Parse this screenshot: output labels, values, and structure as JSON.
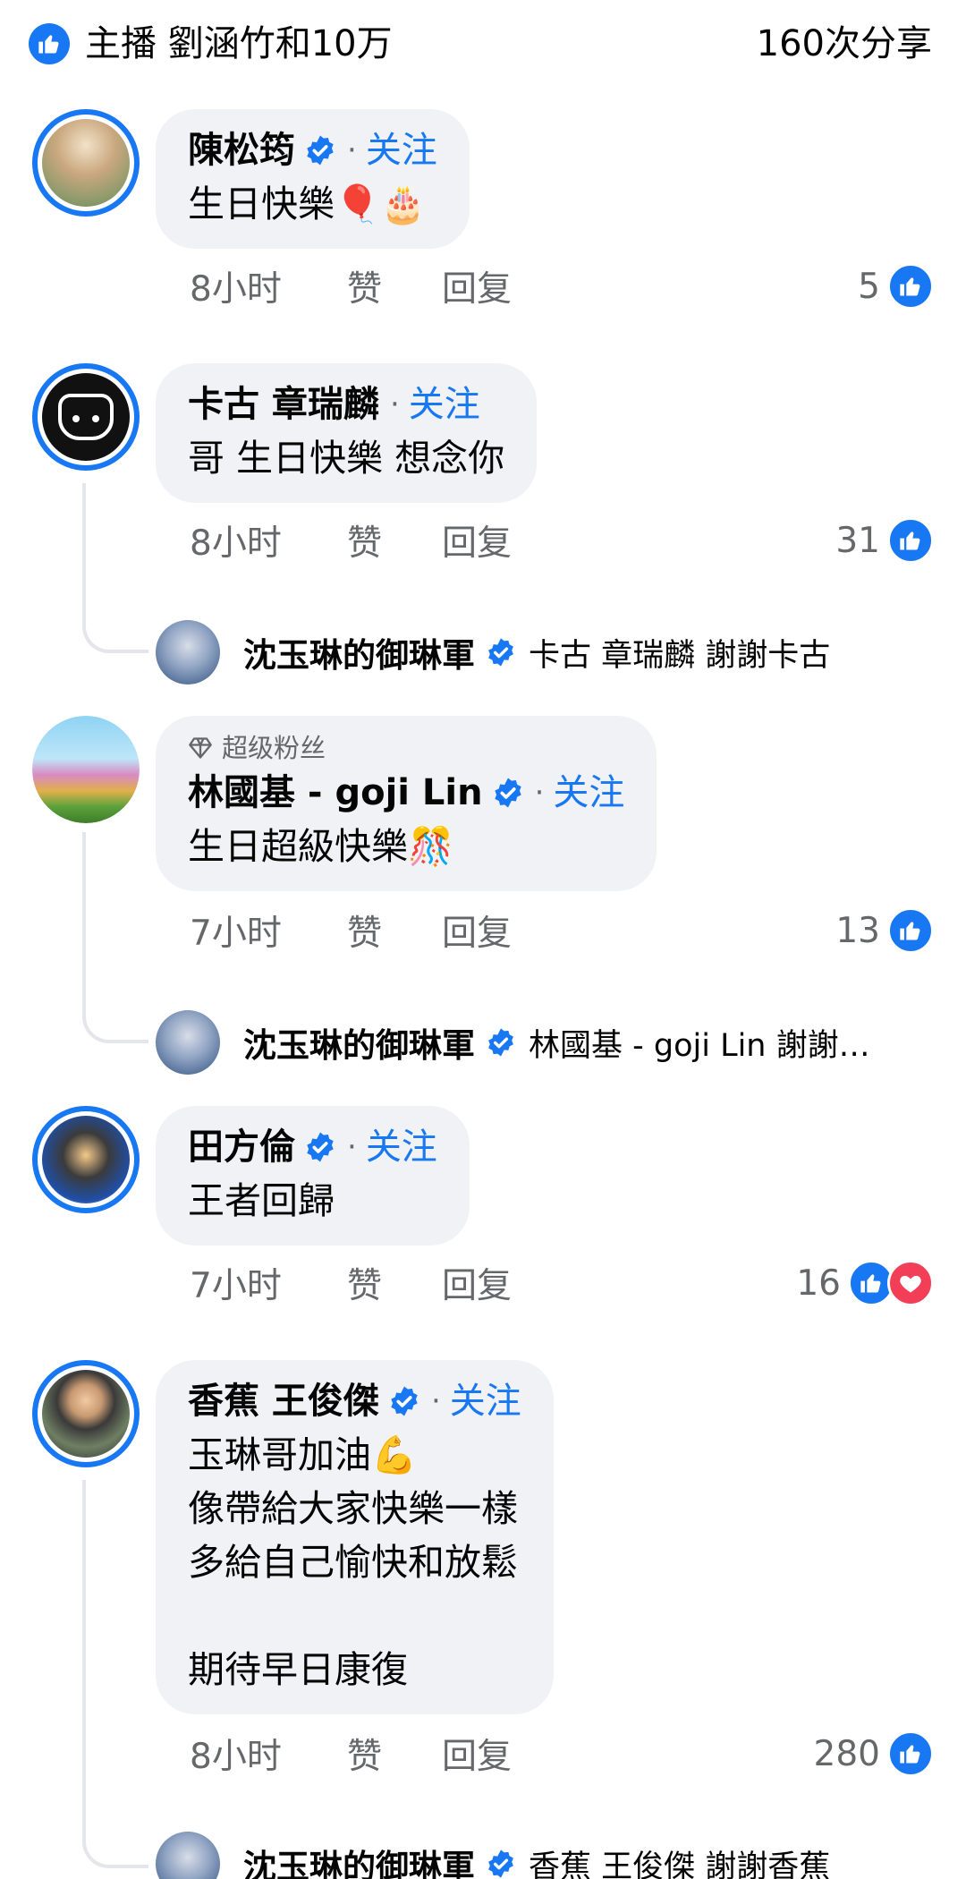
{
  "header": {
    "reactors": "主播 劉涵竹和10万",
    "shares": "160次分享"
  },
  "colors": {
    "accent": "#1877f2",
    "love": "#f33e58",
    "bubble": "#f0f2f5",
    "secondary_text": "#65676b"
  },
  "comments": [
    {
      "name": "陳松筠",
      "verified": true,
      "follow_label": "关注",
      "text": "生日快樂🎈🎂",
      "time": "8小时",
      "like_label": "赞",
      "reply_label": "回复",
      "reaction_count": "5",
      "reactions": [
        "like-icon"
      ]
    },
    {
      "name": "卡古 章瑞麟",
      "verified": false,
      "follow_label": "关注",
      "text": "哥 生日快樂 想念你",
      "time": "8小时",
      "like_label": "赞",
      "reply_label": "回复",
      "reaction_count": "31",
      "reactions": [
        "like-icon"
      ],
      "reply": {
        "name": "沈玉琳的御琳軍",
        "text": "卡古 章瑞麟 謝謝卡古"
      }
    },
    {
      "badge": "超级粉丝",
      "name": "林國基 - goji Lin",
      "verified": true,
      "follow_label": "关注",
      "text": "生日超級快樂🎊",
      "time": "7小时",
      "like_label": "赞",
      "reply_label": "回复",
      "reaction_count": "13",
      "reactions": [
        "like-icon"
      ],
      "reply": {
        "name": "沈玉琳的御琳軍",
        "text": "林國基 - goji Lin 謝謝…"
      }
    },
    {
      "name": "田方倫",
      "verified": true,
      "follow_label": "关注",
      "text": "王者回歸",
      "time": "7小时",
      "like_label": "赞",
      "reply_label": "回复",
      "reaction_count": "16",
      "reactions": [
        "like-icon",
        "love-icon"
      ]
    },
    {
      "name": "香蕉 王俊傑",
      "verified": true,
      "follow_label": "关注",
      "text": "玉琳哥加油💪\n像帶給大家快樂一樣\n多給自己愉快和放鬆\n\n期待早日康復",
      "time": "8小时",
      "like_label": "赞",
      "reply_label": "回复",
      "reaction_count": "280",
      "reactions": [
        "like-icon"
      ],
      "reply": {
        "name": "沈玉琳的御琳軍",
        "text": "香蕉 王俊傑 謝謝香蕉"
      }
    }
  ]
}
